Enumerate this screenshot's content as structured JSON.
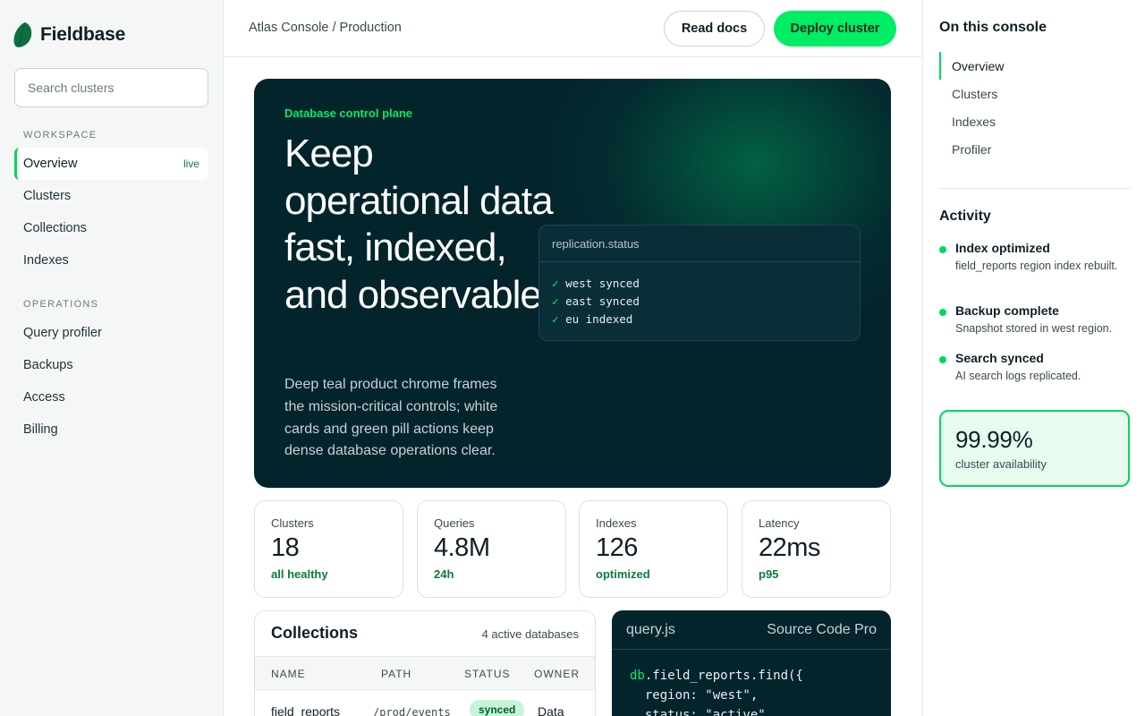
{
  "brand": {
    "name": "Fieldbase"
  },
  "colors": {
    "accent": "#00ed64",
    "hero_bg": "#04242c",
    "link_green": "#0b7a3b"
  },
  "search": {
    "placeholder": "Search clusters"
  },
  "sidebar": {
    "workspace_heading": "WORKSPACE",
    "workspace_items": [
      {
        "label": "Overview",
        "badge": "live",
        "active": true
      },
      {
        "label": "Clusters"
      },
      {
        "label": "Collections"
      },
      {
        "label": "Indexes"
      }
    ],
    "operations_heading": "OPERATIONS",
    "operations_items": [
      {
        "label": "Query profiler"
      },
      {
        "label": "Backups"
      },
      {
        "label": "Access"
      },
      {
        "label": "Billing"
      }
    ]
  },
  "header": {
    "breadcrumb": "Atlas Console / Production",
    "read_docs_label": "Read docs",
    "deploy_label": "Deploy cluster"
  },
  "hero": {
    "eyebrow": "Database control plane",
    "title": "Keep operational data fast, indexed, and observable.",
    "description": "Deep teal product chrome frames the mission-critical controls; white cards and green pill actions keep dense database operations clear.",
    "status_card": {
      "title": "replication.status",
      "check_icon": "✓",
      "lines": [
        "west synced",
        "east synced",
        "eu indexed"
      ]
    }
  },
  "stats": [
    {
      "label": "Clusters",
      "value": "18",
      "note": "all healthy"
    },
    {
      "label": "Queries",
      "value": "4.8M",
      "note": "24h"
    },
    {
      "label": "Indexes",
      "value": "126",
      "note": "optimized"
    },
    {
      "label": "Latency",
      "value": "22ms",
      "note": "p95"
    }
  ],
  "collections": {
    "title": "Collections",
    "count": "4 active databases",
    "columns": [
      "NAME",
      "PATH",
      "STATUS",
      "OWNER"
    ],
    "rows": [
      {
        "name": "field_reports",
        "path": "/prod/events",
        "status": "synced",
        "owner": "Data"
      }
    ]
  },
  "code": {
    "filename": "query.js",
    "font_label": "Source Code Pro",
    "line1_obj": "db",
    "line1_rest": ".field_reports.find({",
    "line2": "  region: \"west\",",
    "line3": "  status: \"active\""
  },
  "rail": {
    "title": "On this console",
    "toc": [
      {
        "label": "Overview",
        "active": true
      },
      {
        "label": "Clusters"
      },
      {
        "label": "Indexes"
      },
      {
        "label": "Profiler"
      }
    ],
    "activity_title": "Activity",
    "activity": [
      {
        "title": "Index optimized",
        "desc": "field_reports region index rebuilt."
      },
      {
        "title": "Backup complete",
        "desc": "Snapshot stored in west region."
      },
      {
        "title": "Search synced",
        "desc": "AI search logs replicated."
      }
    ],
    "availability": {
      "value": "99.99%",
      "label": "cluster availability"
    }
  }
}
